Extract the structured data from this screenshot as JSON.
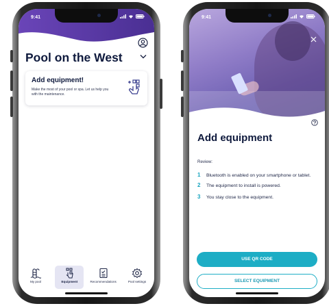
{
  "status_bar": {
    "time": "9:41"
  },
  "left_screen": {
    "pool_name": "Pool on the West",
    "card": {
      "title": "Add equipment!",
      "description": "Make the most of your pool or spa. Let us help you with the maintenance."
    },
    "tabs": [
      {
        "label": "My pool",
        "icon": "pool-ladder-icon",
        "active": false
      },
      {
        "label": "Equipment",
        "icon": "equipment-remote-icon",
        "active": true
      },
      {
        "label": "Recommendations",
        "icon": "checklist-icon",
        "active": false
      },
      {
        "label": "Pool settings",
        "icon": "gear-icon",
        "active": false
      }
    ]
  },
  "right_screen": {
    "title": "Add equipment",
    "review_label": "Review:",
    "steps": [
      {
        "number": "1",
        "text": "Bluetooth is enabled on your smartphone or tablet."
      },
      {
        "number": "2",
        "text": "The equipment to install is powered."
      },
      {
        "number": "3",
        "text": "You stay close to the equipment."
      }
    ],
    "primary_button": "USE QR CODE",
    "secondary_button": "SELECT EQUIPMENT"
  },
  "colors": {
    "header_purple": "#5b3fa6",
    "accent_teal": "#1dadc5",
    "text_navy": "#0f1a3d"
  }
}
